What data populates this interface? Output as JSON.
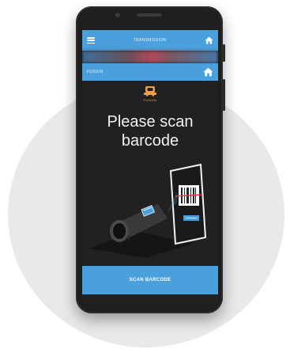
{
  "app": {
    "header_title": "TRANSMISSION",
    "sub_header_title": "FUSION",
    "brand_label": "FUSION"
  },
  "content": {
    "headline_line1": "Please scan",
    "headline_line2": "barcode"
  },
  "actions": {
    "scan_button_label": "SCAN BARCODE"
  },
  "colors": {
    "accent": "#4a9fdd",
    "screen_bg": "#212121",
    "brand": "#f0a040"
  }
}
